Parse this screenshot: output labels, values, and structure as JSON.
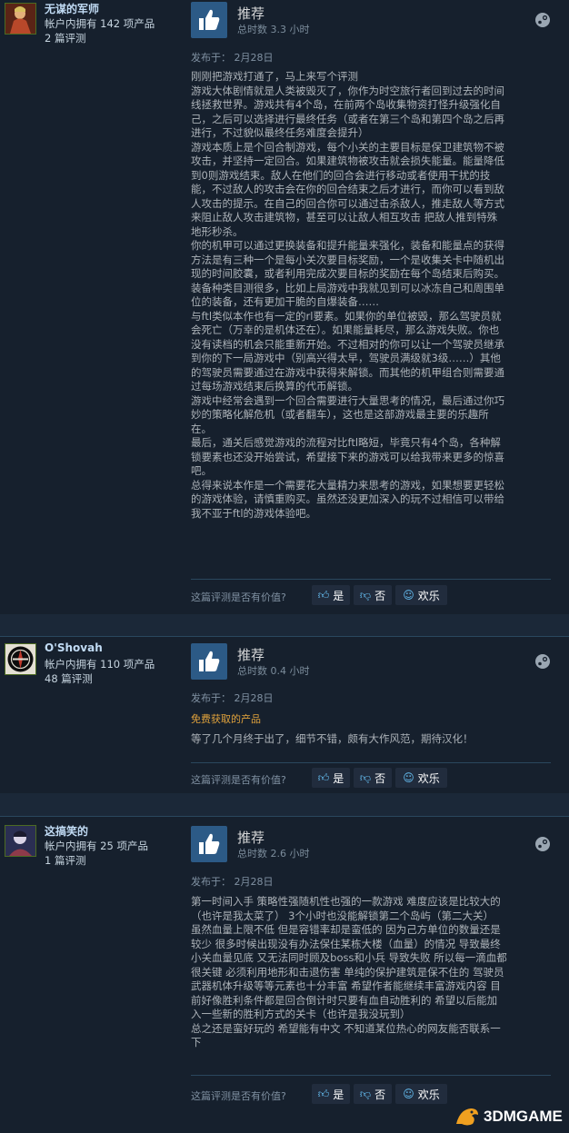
{
  "reviews": [
    {
      "user": {
        "name": "无谋的军师",
        "products": "帐户内拥有 142 项产品",
        "reviews": "2 篇评测"
      },
      "verdict": "推荐",
      "hours": "总时数 3.3 小时",
      "posted": "发布于：  2月28日",
      "lines": [
        "刚刚把游戏打通了，马上来写个评测",
        "游戏大体剧情就是人类被毁灭了，你作为时空旅行者回到过去的时间",
        "线拯救世界。游戏共有4个岛，在前两个岛收集物资打怪升级强化自",
        "己，之后可以选择进行最终任务（或者在第三个岛和第四个岛之后再",
        "进行，不过貌似最终任务难度会提升）",
        "游戏本质上是个回合制游戏，每个小关的主要目标是保卫建筑物不被",
        "攻击，并坚持一定回合。如果建筑物被攻击就会损失能量。能量降低",
        "到0则游戏结束。敌人在他们的回合会进行移动或者使用干扰的技",
        "能，不过敌人的攻击会在你的回合结束之后才进行，而你可以看到敌",
        "人攻击的提示。在自己的回合你可以通过击杀敌人，推走敌人等方式",
        "来阻止敌人攻击建筑物，甚至可以让敌人相互攻击 把敌人推到特殊",
        "地形秒杀。",
        "你的机甲可以通过更换装备和提升能量来强化，装备和能量点的获得",
        "方法是有三种一个是每小关次要目标奖励，一个是收集关卡中随机出",
        "现的时间胶囊，或者利用完成次要目标的奖励在每个岛结束后购买。",
        "装备种类目测很多，比如上局游戏中我就见到可以冰冻自己和周围单",
        "位的装备，还有更加干脆的自爆装备……",
        "与ftl类似本作也有一定的rl要素。如果你的单位被毁，那么驾驶员就",
        "会死亡（万幸的是机体还在）。如果能量耗尽，那么游戏失败。你也",
        "没有读档的机会只能重新开始。不过相对的你可以让一个驾驶员继承",
        "到你的下一局游戏中（别高兴得太早，驾驶员满级就3级……）其他",
        "的驾驶员需要通过在游戏中获得来解锁。而其他的机甲组合则需要通",
        "过每场游戏结束后换算的代币解锁。",
        "游戏中经常会遇到一个回合需要进行大量思考的情况，最后通过你巧",
        "妙的策略化解危机（或者翻车），这也是这部游戏最主要的乐趣所",
        "在。",
        "最后，通关后感觉游戏的流程对比ftl略短，毕竟只有4个岛，各种解",
        "锁要素也还没开始尝试，希望接下来的游戏可以给我带来更多的惊喜",
        "吧。",
        "总得来说本作是一个需要花大量精力来思考的游戏，如果想要更轻松",
        "的游戏体验，请慎重购买。虽然还没更加深入的玩不过相信可以带给",
        "我不亚于ftl的游戏体验吧。"
      ]
    },
    {
      "user": {
        "name": "O'Shovah",
        "products": "帐户内拥有 110 项产品",
        "reviews": "48 篇评测"
      },
      "verdict": "推荐",
      "hours": "总时数 0.4 小时",
      "posted": "发布于：  2月28日",
      "free": "免费获取的产品",
      "lines": [
        "等了几个月终于出了，细节不错，颇有大作风范，期待汉化！"
      ]
    },
    {
      "user": {
        "name": "这搞笑的",
        "products": "帐户内拥有 25 项产品",
        "reviews": "1 篇评测"
      },
      "verdict": "推荐",
      "hours": "总时数 2.6 小时",
      "posted": "发布于：  2月28日",
      "lines": [
        "第一时间入手 策略性强随机性也强的一款游戏 难度应该是比较大的",
        "（也许是我太菜了） 3个小时也没能解锁第二个岛屿（第二大关）",
        "虽然血量上限不低 但是容错率却是蛮低的 因为己方单位的数量还是",
        "较少 很多时候出现没有办法保住某栋大楼（血量）的情况 导致最终",
        "小关血量见底 又无法同时顾及boss和小兵 导致失败 所以每一滴血都",
        "很关键 必须利用地形和击退伤害 单纯的保护建筑是保不住的 驾驶员",
        "武器机体升级等等元素也十分丰富 希望作者能继续丰富游戏内容 目",
        "前好像胜利条件都是回合倒计时只要有血自动胜利的 希望以后能加",
        "入一些新的胜利方式的关卡（也许是我没玩到）",
        "总之还是蛮好玩的 希望能有中文 不知道某位热心的网友能否联系一",
        "下"
      ]
    }
  ],
  "helpful": {
    "question": "这篇评测是否有价值?",
    "yes": "是",
    "no": "否",
    "funny": "欢乐"
  },
  "watermark": "3DMGAME",
  "colors": {
    "background": "#1b2838",
    "card": "#16202d",
    "thumb_box": "#2c5a86",
    "free_tag": "#e0a23c",
    "link_blue": "#66c0f4"
  }
}
